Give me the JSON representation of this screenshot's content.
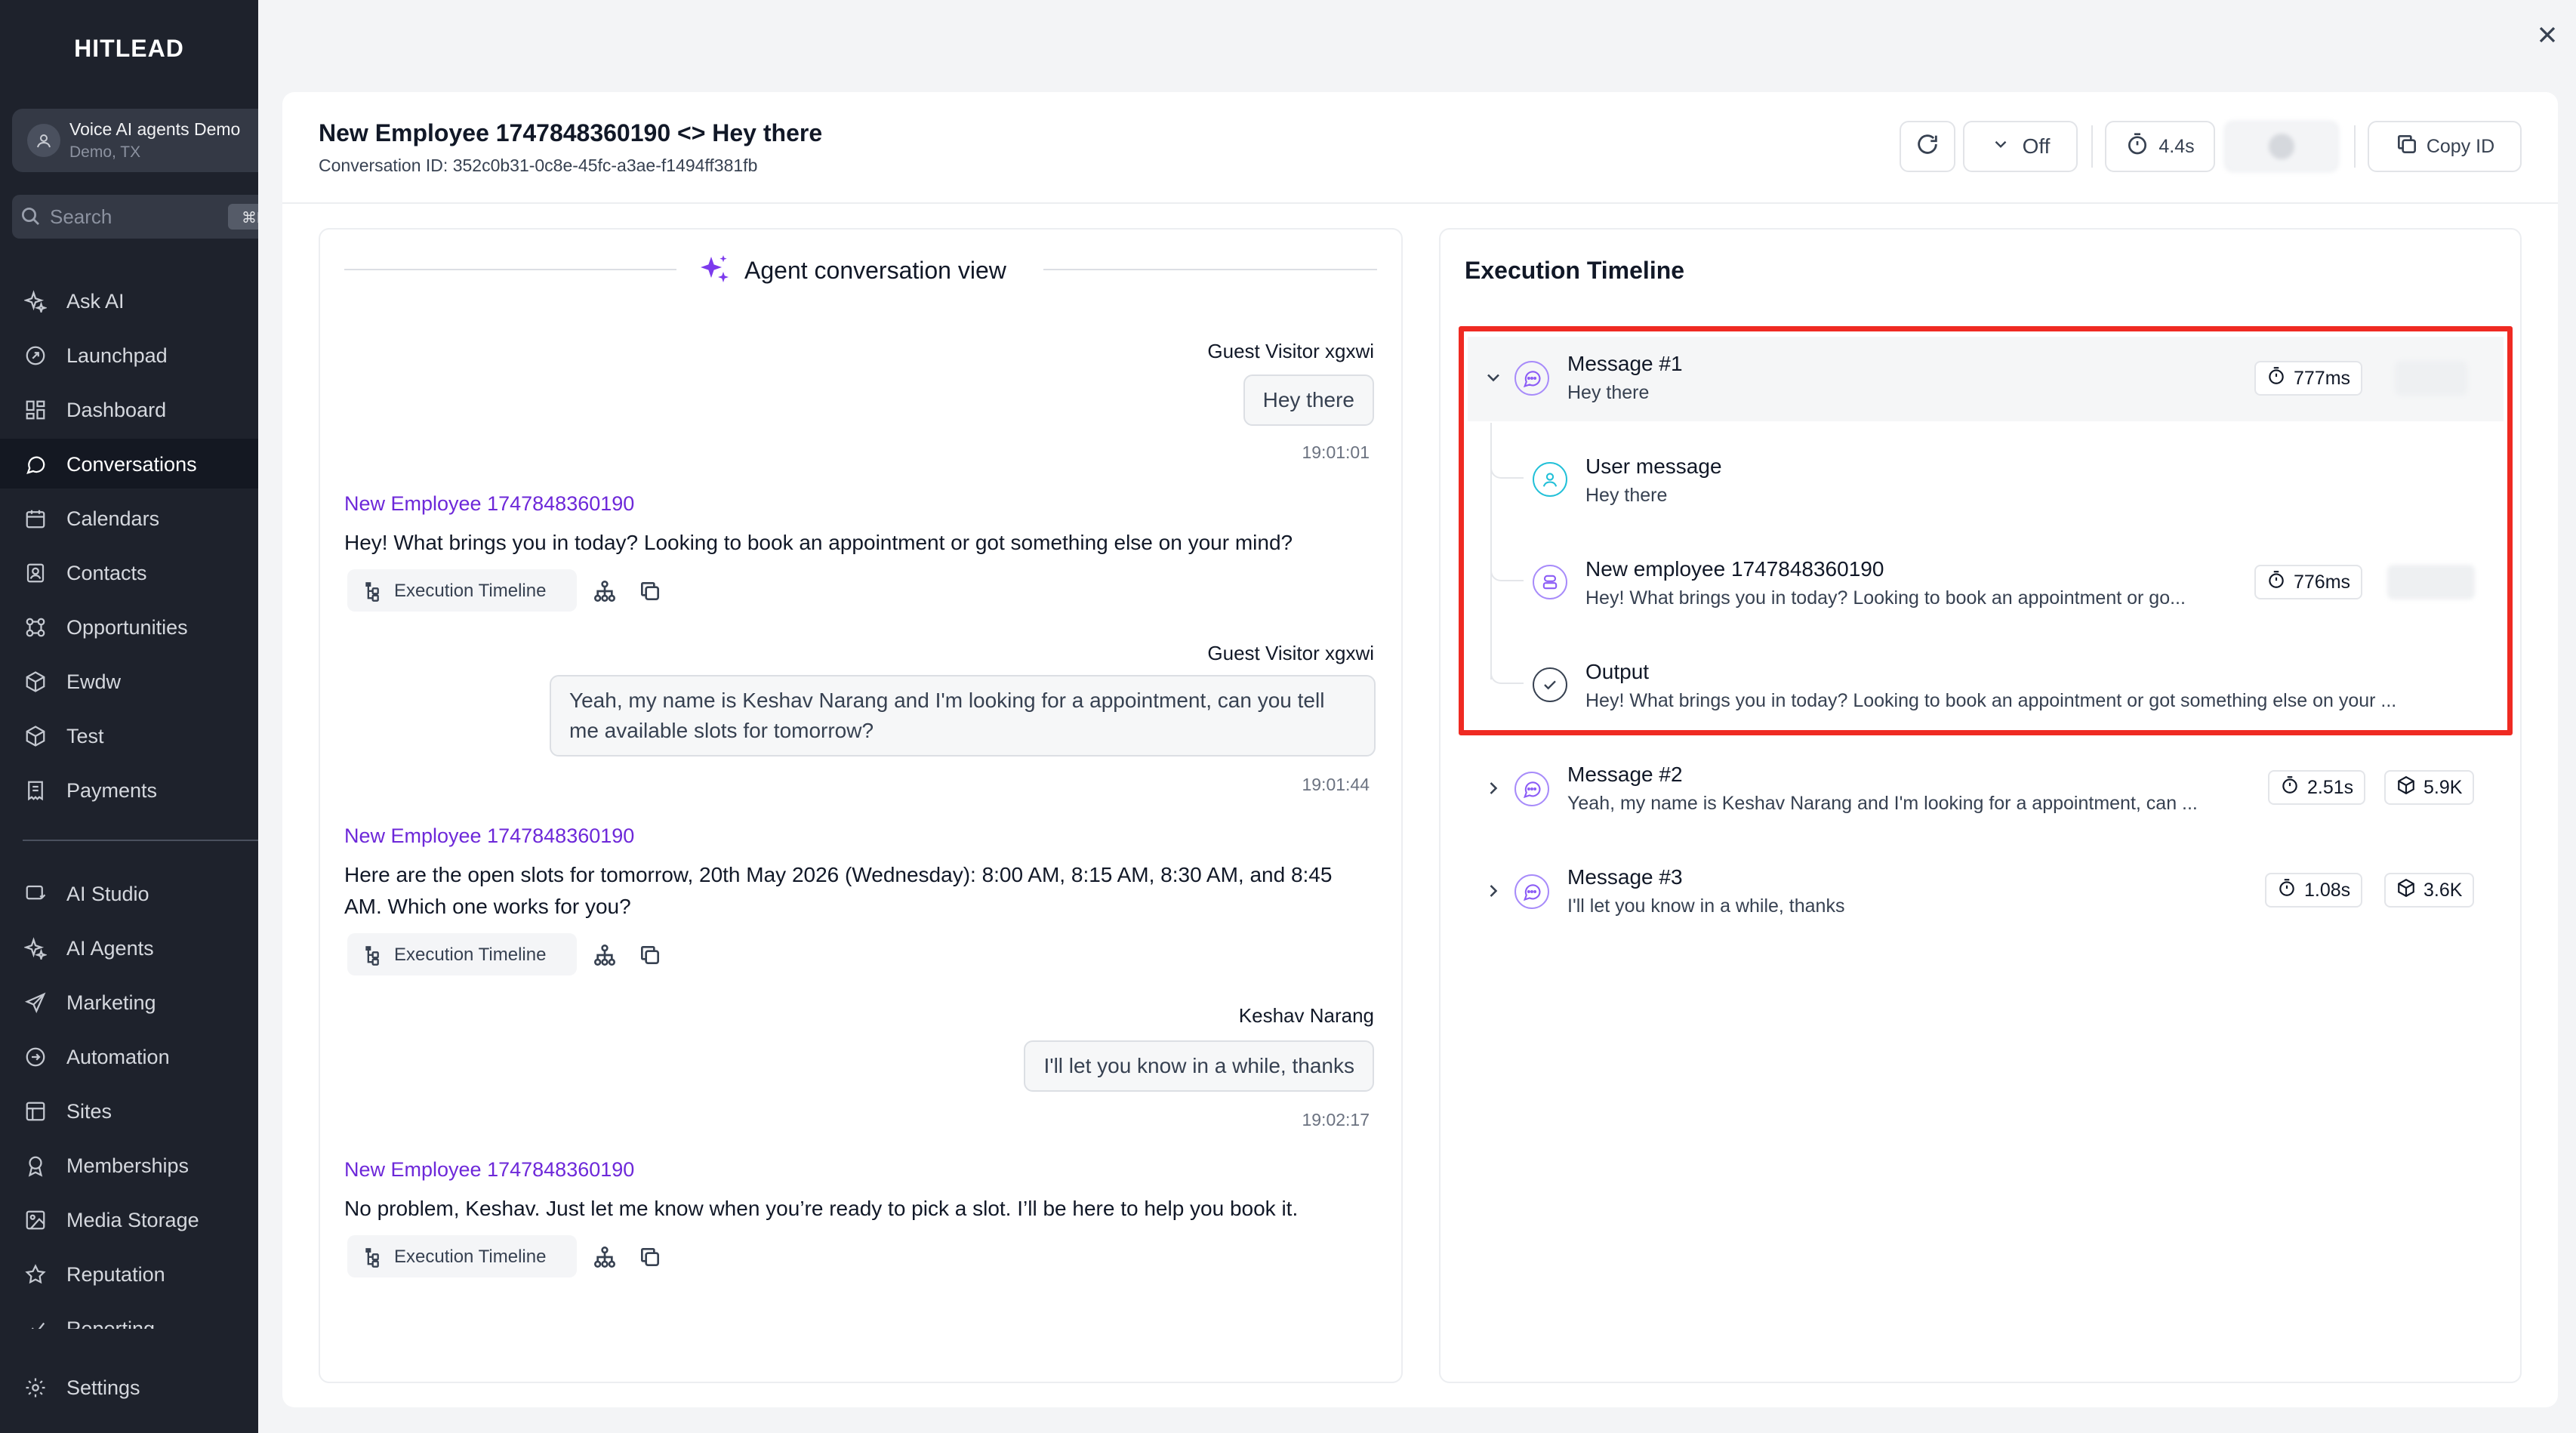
{
  "sidebar": {
    "brand": "HITLEAD",
    "account": {
      "name": "Voice AI agents Demo",
      "location": "Demo, TX"
    },
    "search": {
      "placeholder": "Search",
      "shortcut": "⌘K"
    },
    "items": [
      {
        "label": "Ask AI",
        "icon": "sparkle-icon"
      },
      {
        "label": "Launchpad",
        "icon": "rocket-icon"
      },
      {
        "label": "Dashboard",
        "icon": "grid-icon"
      },
      {
        "label": "Conversations",
        "icon": "chat-bubble-icon",
        "active": true
      },
      {
        "label": "Calendars",
        "icon": "calendar-icon"
      },
      {
        "label": "Contacts",
        "icon": "contacts-icon"
      },
      {
        "label": "Opportunities",
        "icon": "opportunities-icon"
      },
      {
        "label": "Ewdw",
        "icon": "cube-icon"
      },
      {
        "label": "Test",
        "icon": "cube-icon"
      },
      {
        "label": "Payments",
        "icon": "receipt-icon"
      }
    ],
    "items2": [
      {
        "label": "AI Studio",
        "icon": "ai-studio-icon"
      },
      {
        "label": "AI Agents",
        "icon": "sparkle-icon"
      },
      {
        "label": "Marketing",
        "icon": "send-icon"
      },
      {
        "label": "Automation",
        "icon": "automation-icon"
      },
      {
        "label": "Sites",
        "icon": "sites-icon"
      },
      {
        "label": "Memberships",
        "icon": "award-icon"
      },
      {
        "label": "Media Storage",
        "icon": "image-icon"
      },
      {
        "label": "Reputation",
        "icon": "star-icon"
      },
      {
        "label": "Reporting",
        "icon": "chart-line-icon"
      }
    ],
    "settings": "Settings"
  },
  "header": {
    "title": "New Employee 1747848360190 <> Hey there",
    "conversation_id": "Conversation ID: 352c0b31-0c8e-45fc-a3ae-f1494ff381fb",
    "toggle_label": "Off",
    "duration": "4.4s",
    "copy_id": "Copy ID"
  },
  "conversation": {
    "title": "Agent conversation view",
    "execution_timeline_label": "Execution Timeline",
    "messages": [
      {
        "role": "visitor",
        "sender": "Guest Visitor xgxwi",
        "text": "Hey there",
        "time": "19:01:01"
      },
      {
        "role": "agent",
        "sender": "New Employee 1747848360190",
        "text": "Hey! What brings you in today? Looking to book an appointment or got something else on your mind?"
      },
      {
        "role": "visitor",
        "sender": "Guest Visitor xgxwi",
        "text": "Yeah, my name is Keshav Narang and I'm looking for a appointment, can you tell me available slots for tomorrow?",
        "time": "19:01:44"
      },
      {
        "role": "agent",
        "sender": "New Employee 1747848360190",
        "text": "Here are the open slots for tomorrow, 20th May 2026 (Wednesday): 8:00 AM, 8:15 AM, 8:30 AM, and 8:45 AM. Which one works for you?"
      },
      {
        "role": "visitor",
        "sender": "Keshav Narang",
        "text": "I'll let you know in a while, thanks",
        "time": "19:02:17"
      },
      {
        "role": "agent",
        "sender": "New Employee 1747848360190",
        "text": "No problem, Keshav. Just let me know when you’re ready to pick a slot. I’ll be here to help you book it."
      }
    ]
  },
  "timeline": {
    "title": "Execution Timeline",
    "messages": [
      {
        "name": "Message #1",
        "preview": "Hey there",
        "duration": "777ms",
        "expanded": true
      },
      {
        "name": "Message #2",
        "preview": "Yeah, my name is Keshav Narang and I'm looking for a appointment, can ...",
        "duration": "2.51s",
        "tokens": "5.9K"
      },
      {
        "name": "Message #3",
        "preview": "I'll let you know in a while, thanks",
        "duration": "1.08s",
        "tokens": "3.6K"
      }
    ],
    "steps": [
      {
        "name": "User message",
        "preview": "Hey there"
      },
      {
        "name": "New employee 1747848360190",
        "preview": "Hey! What brings you in today? Looking to book an appointment or go...",
        "duration": "776ms"
      },
      {
        "name": "Output",
        "preview": "Hey! What brings you in today? Looking to book an appointment or got something else on your ..."
      }
    ],
    "highlight_color": "#ef2a22"
  },
  "colors": {
    "accent": "#6d28d9",
    "sidebar_bg": "#1e222c"
  }
}
